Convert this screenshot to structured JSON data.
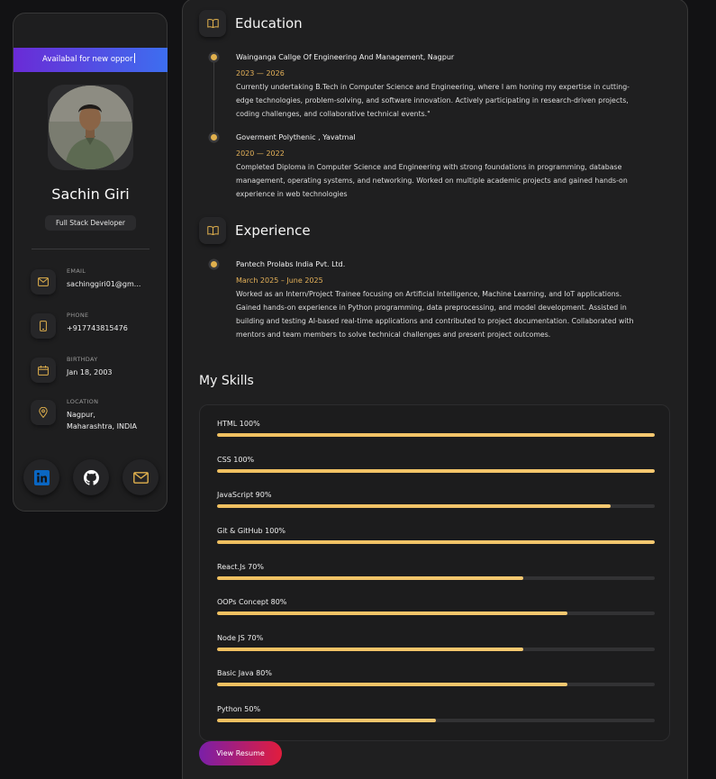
{
  "profile": {
    "status": "Availabal for new oppor",
    "name": "Sachin Giri",
    "title": "Full Stack Developer"
  },
  "contacts": [
    {
      "icon": "mail-icon",
      "label": "EMAIL",
      "value": "sachinggiri01@gm..."
    },
    {
      "icon": "phone-icon",
      "label": "PHONE",
      "value": "+917743815476"
    },
    {
      "icon": "calendar-icon",
      "label": "BIRTHDAY",
      "value": "Jan 18, 2003"
    },
    {
      "icon": "location-icon",
      "label": "LOCATION",
      "value": "Nagpur,\nMaharashtra, INDIA"
    }
  ],
  "socials": [
    "linkedin-icon",
    "github-icon",
    "mail-icon"
  ],
  "education": {
    "title": "Education",
    "items": [
      {
        "org": "Wainganga Callge Of Engineering And Management, Nagpur",
        "date": "2023 — 2026",
        "desc": "Currently undertaking B.Tech in Computer Science and Engineering, where I am honing my expertise in cutting-edge technologies, problem-solving, and software innovation. Actively participating in research-driven projects, coding challenges, and collaborative technical events.\""
      },
      {
        "org": "Goverment Polythenic , Yavatmal",
        "date": "2020 — 2022",
        "desc": "Completed Diploma in Computer Science and Engineering with strong foundations in programming, database management, operating systems, and networking. Worked on multiple academic projects and gained hands-on experience in web technologies"
      }
    ]
  },
  "experience": {
    "title": "Experience",
    "items": [
      {
        "org": "Pantech Prolabs India Pvt. Ltd.",
        "date": "March 2025 – June 2025",
        "desc": "Worked as an Intern/Project Trainee focusing on Artificial Intelligence, Machine Learning, and IoT applications. Gained hands-on experience in Python programming, data preprocessing, and model development. Assisted in building and testing AI-based real-time applications and contributed to project documentation. Collaborated with mentors and team members to solve technical challenges and present project outcomes."
      }
    ]
  },
  "skills": {
    "title": "My Skills",
    "items": [
      {
        "label": "HTML 100%",
        "percent": 100
      },
      {
        "label": "CSS 100%",
        "percent": 100
      },
      {
        "label": "JavaScript 90%",
        "percent": 90
      },
      {
        "label": "Git & GitHub 100%",
        "percent": 100
      },
      {
        "label": "React.Js 70%",
        "percent": 70
      },
      {
        "label": "OOPs Concept 80%",
        "percent": 80
      },
      {
        "label": "Node JS 70%",
        "percent": 70
      },
      {
        "label": "Basic Java 80%",
        "percent": 80
      },
      {
        "label": "Python 50%",
        "percent": 50
      }
    ]
  },
  "resume_button": "View Resume",
  "colors": {
    "accent": "#e4b159",
    "bar_fill": "#f3c466",
    "banner_start": "#6a2bd6",
    "banner_end": "#3d6ef0"
  }
}
